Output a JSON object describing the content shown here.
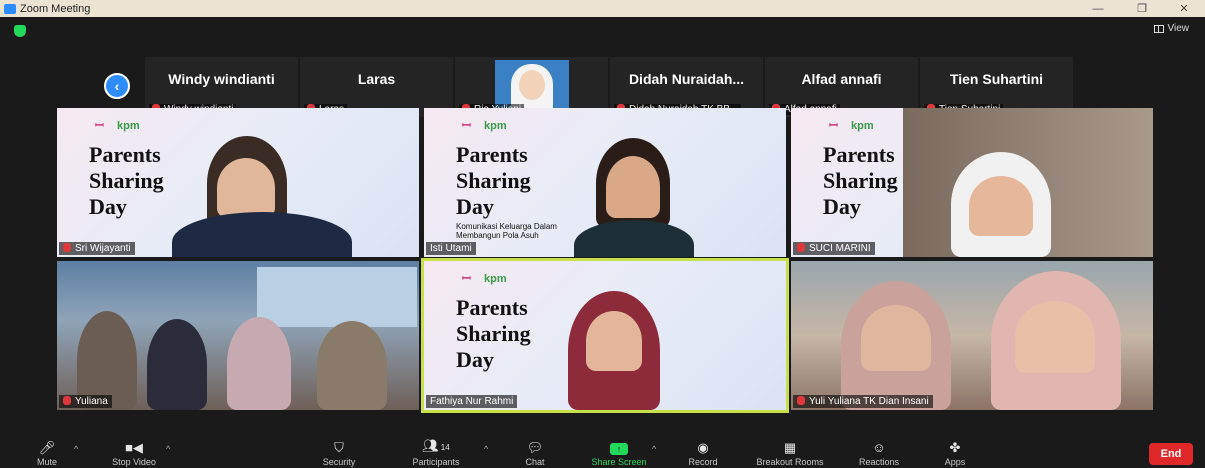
{
  "window": {
    "title": "Zoom Meeting",
    "minimize": "—",
    "restore": "❐",
    "close": "✕"
  },
  "view_label": "View",
  "strip": [
    {
      "big": "Windy windianti",
      "small": "Windy windianti"
    },
    {
      "big": "Laras",
      "small": "Laras"
    },
    {
      "big": "",
      "small": "Ria Yuliani",
      "photo": true
    },
    {
      "big": "Didah  Nuraidah...",
      "small": "Didah Nuraidah TK BB..."
    },
    {
      "big": "Alfad annafi",
      "small": "Alfad annafi"
    },
    {
      "big": "Tien Suhartini",
      "small": "Tien Suhartini"
    }
  ],
  "slide": {
    "logo_left": "kpm",
    "title_lines": [
      "Parents",
      "Sharing",
      "Day"
    ],
    "subtitle": "Komunikasi Keluarga Dalam Membangun Pola Asuh"
  },
  "tiles": [
    {
      "name": "Sri Wijayanti",
      "slide": true
    },
    {
      "name": "Isti Utami",
      "slide": true
    },
    {
      "name": "SUCI MARINI",
      "slide": true
    },
    {
      "name": "Yuliana",
      "slide": false
    },
    {
      "name": "Fathiya Nur Rahmi",
      "slide": true,
      "active": true
    },
    {
      "name": "Yuli Yuliana TK Dian Insani",
      "slide": false
    }
  ],
  "toolbar": {
    "mute": "Mute",
    "stop_video": "Stop Video",
    "security": "Security",
    "participants": "Participants",
    "participants_count": "14",
    "chat": "Chat",
    "share_screen": "Share Screen",
    "record": "Record",
    "breakout_rooms": "Breakout Rooms",
    "reactions": "Reactions",
    "apps": "Apps",
    "end": "End"
  },
  "colors": {
    "accent": "#2d8cff",
    "share": "#23d959",
    "end": "#e02828",
    "active_border": "#c7e04a"
  }
}
